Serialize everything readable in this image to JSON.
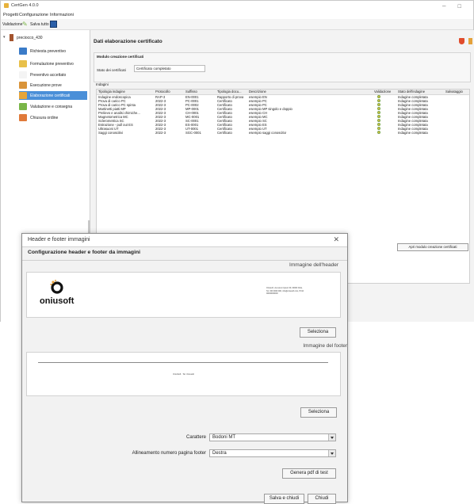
{
  "window": {
    "title": "CertGen 4.0.0",
    "menu": [
      "Progetti",
      "Configurazione",
      "Informazioni"
    ],
    "toolbar": {
      "validation_label": "Validazione",
      "save_all_label": "Salva tutto"
    }
  },
  "tree": {
    "root_label": "preciocco_430",
    "items": [
      {
        "label": "Richiesta preventivo",
        "color": "#3a7bc8"
      },
      {
        "label": "Formulazione preventivo",
        "color": "#e8c04a"
      },
      {
        "label": "Preventivo accettato",
        "color": "#f4f4f4"
      },
      {
        "label": "Esecuzione prove",
        "color": "#d9943a"
      },
      {
        "label": "Elaborazione certificati",
        "color": "#e6a53a"
      },
      {
        "label": "Valutazione e consegna",
        "color": "#7ab648"
      },
      {
        "label": "Chiusura ordine",
        "color": "#e07a3a"
      }
    ],
    "selected_index": 4
  },
  "content": {
    "header": "Dati elaborazione certificato",
    "section1_title": "Modulo creazione certificati",
    "status_label": "Stato dei certificati",
    "status_value": "Certificato completato",
    "section2_title": "Indagini",
    "columns": [
      "Tipologia indagine",
      "Protocollo",
      "Suffisso",
      "Tipologia docu...",
      "Descrizione",
      "Validazione",
      "Stato dell'indagine",
      "Salvataggio"
    ],
    "rows": [
      [
        "Indagine endoscopica",
        "RAP-3",
        "EN-0001",
        "Rapporto di prova",
        "esempio EN",
        "",
        "Indagine completata",
        ""
      ],
      [
        "Prova di carico PC",
        "2022-3",
        "PC-0001",
        "Certificato",
        "esempio PC",
        "",
        "Indagine completata",
        ""
      ],
      [
        "Prova di carico PC spinta",
        "2022-3",
        "PC-0002",
        "Certificato",
        "esempio PC",
        "",
        "Indagine completata",
        ""
      ],
      [
        "Martinetti piatti MP",
        "2022-3",
        "MP-0001",
        "Certificato",
        "esempio MP singolo e doppio",
        "",
        "Indagine completata",
        ""
      ],
      [
        "Prelievo e analisi chimiche...",
        "2022-3",
        "CH-0001",
        "Certificato",
        "esempio CH",
        "",
        "Indagine completata",
        ""
      ],
      [
        "Magnetometrica MC",
        "2022-3",
        "MC-0001",
        "Certificato",
        "esempio MC",
        "",
        "Indagine completata",
        ""
      ],
      [
        "Sclerometrica SC",
        "2022-3",
        "SC-0001",
        "Certificato",
        "esempio SC",
        "",
        "Indagine completata",
        ""
      ],
      [
        "Estrazione - pull out ES",
        "2022-3",
        "ES-0001",
        "Certificato",
        "esempio ES",
        "",
        "Indagine completata",
        ""
      ],
      [
        "Ultrasuoni UT",
        "2022-3",
        "UT-0001",
        "Certificato",
        "esempio UT",
        "",
        "Indagine completata",
        ""
      ],
      [
        "Saggi conoscitivi",
        "2022-3",
        "SGC-0001",
        "Certificato",
        "esempio saggi conoscitivi",
        "",
        "Indagine completata",
        ""
      ]
    ],
    "open_module_button": "Apri modulo creazione certificati"
  },
  "dialog": {
    "title": "Header e footer immagini",
    "heading": "Configurazione header e footer da immagini",
    "header_image_label": "Immagine dell'header",
    "footer_image_label": "Immagine del footer",
    "select_button": "Seleziona",
    "logo_text": "oniusoft",
    "header_address": "Oniusoft, via Lorem Ipsum 00, 00000 Città, Tel. 000 0000 000, info@oniusoft.com, P.IVA 00000000000",
    "footer_text": "OnioSoft · Tel. Oniusoft",
    "font_label": "Carattere",
    "font_value": "Bodoni MT",
    "align_label": "Allineamento numero pagina footer",
    "align_value": "Destra",
    "test_button": "Genera pdf di test",
    "save_close_button": "Salva e chiudi",
    "close_button": "Chiudi"
  }
}
